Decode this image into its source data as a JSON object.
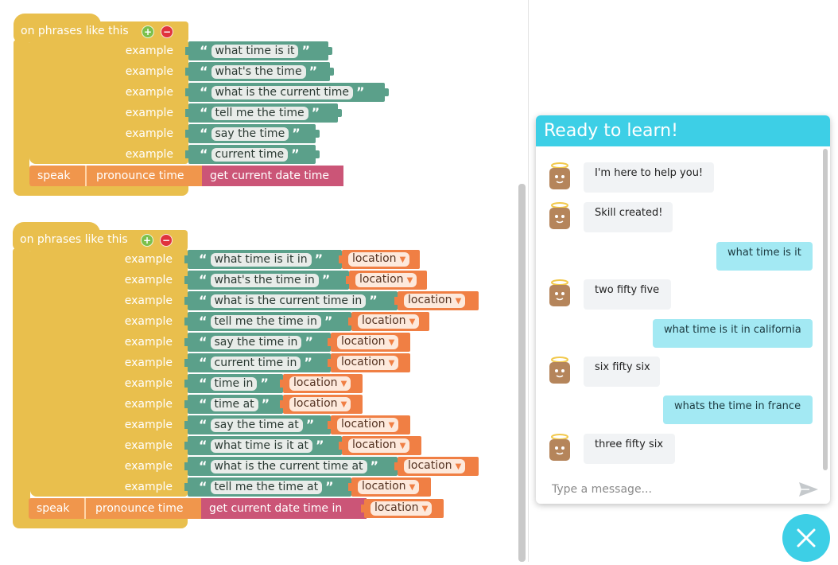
{
  "colors": {
    "hat": "#e9bf4d",
    "quote_block": "#5ba08a",
    "location_block": "#f07f44",
    "speak_block": "#f0964c",
    "time_block": "#cb5577",
    "chat_accent": "#3dcfe6",
    "user_bubble": "#a3e9f3"
  },
  "workspace": {
    "block1": {
      "title": "on phrases like this",
      "example_label": "example",
      "examples": [
        "what time is it",
        "what's the time",
        "what is the current time",
        "tell me the time",
        "say the time",
        "current time"
      ],
      "speak": "speak",
      "pronounce": "pronounce time",
      "get_time": "get current date time"
    },
    "block2": {
      "title": "on phrases like this",
      "example_label": "example",
      "examples": [
        "what time is it in",
        "what's the time in",
        "what is the current time in",
        "tell me the time in",
        "say the time in",
        "current time in",
        "time in",
        "time at",
        "say the time at",
        "what time is it at",
        "what is the current time at",
        "tell me the time at"
      ],
      "location": "location",
      "speak": "speak",
      "pronounce": "pronounce time",
      "get_time": "get current date time in"
    }
  },
  "chat": {
    "title": "Ready to learn!",
    "messages": [
      {
        "from": "bot",
        "text": "I'm here to help you!"
      },
      {
        "from": "bot",
        "text": "Skill created!"
      },
      {
        "from": "user",
        "text": "what time is it"
      },
      {
        "from": "bot",
        "text": "two fifty five"
      },
      {
        "from": "user",
        "text": "what time is it in california"
      },
      {
        "from": "bot",
        "text": "six fifty six"
      },
      {
        "from": "user",
        "text": "whats the time in france"
      },
      {
        "from": "bot",
        "text": "three fifty six"
      }
    ],
    "input_placeholder": "Type a message...",
    "send_icon": "send-icon",
    "close_icon": "close-icon"
  }
}
